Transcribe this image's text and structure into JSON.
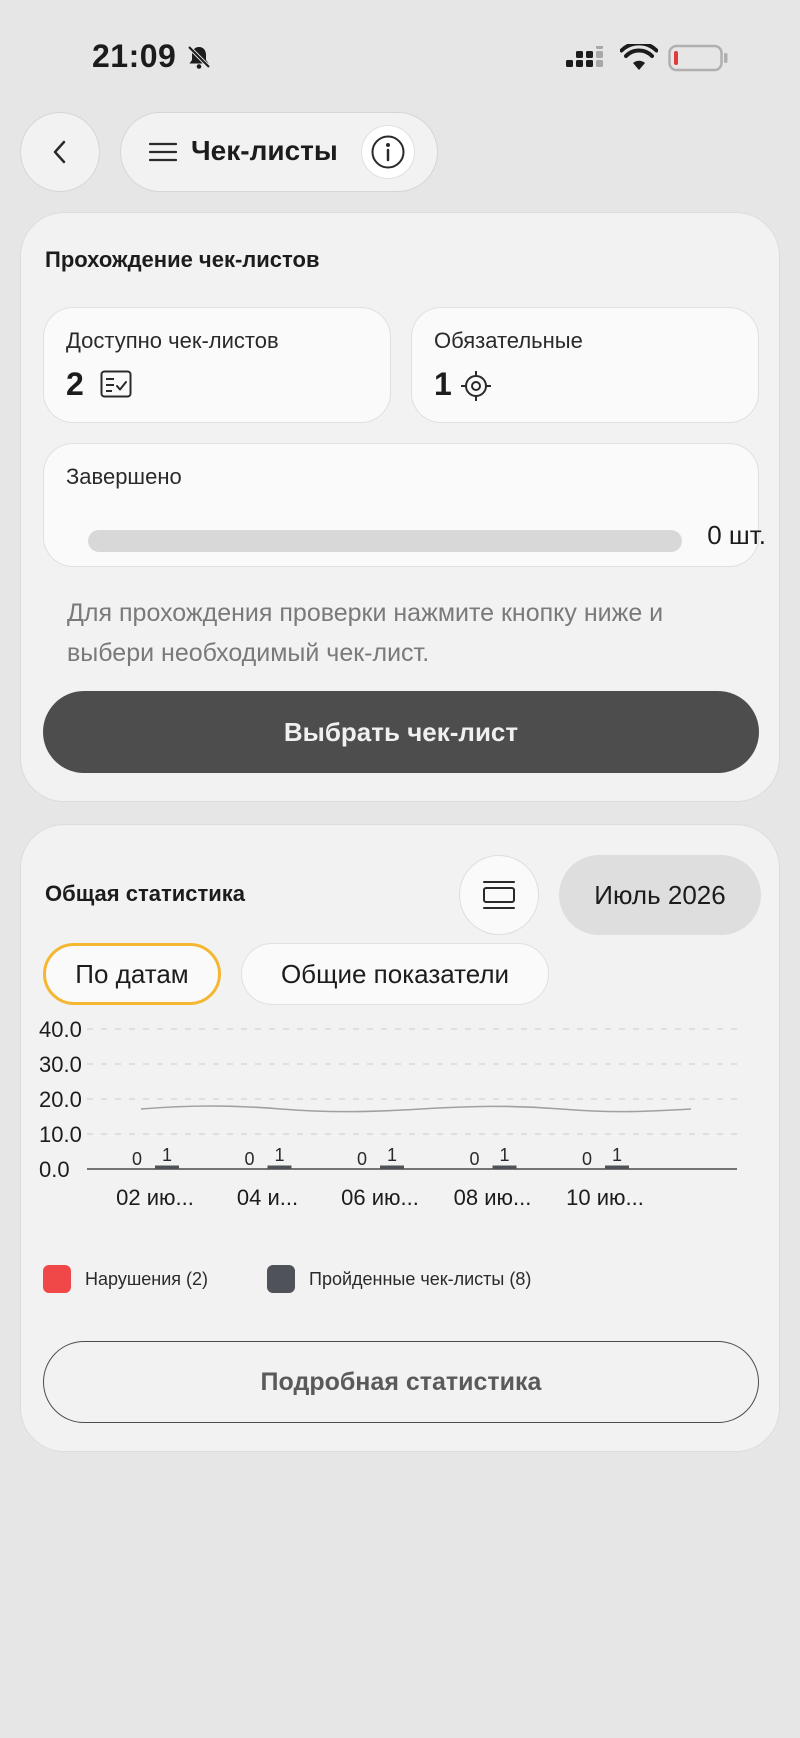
{
  "status_bar": {
    "time": "21:09"
  },
  "header": {
    "title": "Чек-листы"
  },
  "checklists": {
    "section_title": "Прохождение чек-листов",
    "available": {
      "label": "Доступно чек-листов",
      "value": "2"
    },
    "required": {
      "label": "Обязательные",
      "value": "1"
    },
    "completed": {
      "label": "Завершено",
      "count_text": "0 шт.",
      "progress": 0
    },
    "hint": "Для прохождения проверки нажмите кнопку ниже и выбери необходимый чек-лист.",
    "select_button": "Выбрать чек-лист"
  },
  "statistics": {
    "section_title": "Общая статистика",
    "month": "Июль 2026",
    "tabs": [
      {
        "label": "По датам",
        "active": true
      },
      {
        "label": "Общие показатели",
        "active": false
      }
    ],
    "details_button": "Подробная статистика"
  },
  "chart_data": {
    "type": "bar",
    "categories": [
      "02 ию...",
      "04 и...",
      "06 ию...",
      "08 ию...",
      "10 ию..."
    ],
    "series": [
      {
        "name": "Нарушения (2)",
        "color": "#f04848",
        "values": [
          0,
          0,
          0,
          0,
          0
        ]
      },
      {
        "name": "Пройденные чек-листы (8)",
        "color": "#4f5359",
        "values": [
          1,
          1,
          1,
          1,
          1
        ]
      }
    ],
    "ylim": [
      0,
      40
    ],
    "y_ticks": [
      "0.0",
      "10.0",
      "20.0",
      "30.0",
      "40.0"
    ],
    "grid": true,
    "legend": "bottom-left"
  },
  "colors": {
    "accent": "#f5b731",
    "primary": "#4d4d4d",
    "danger": "#f04848"
  }
}
